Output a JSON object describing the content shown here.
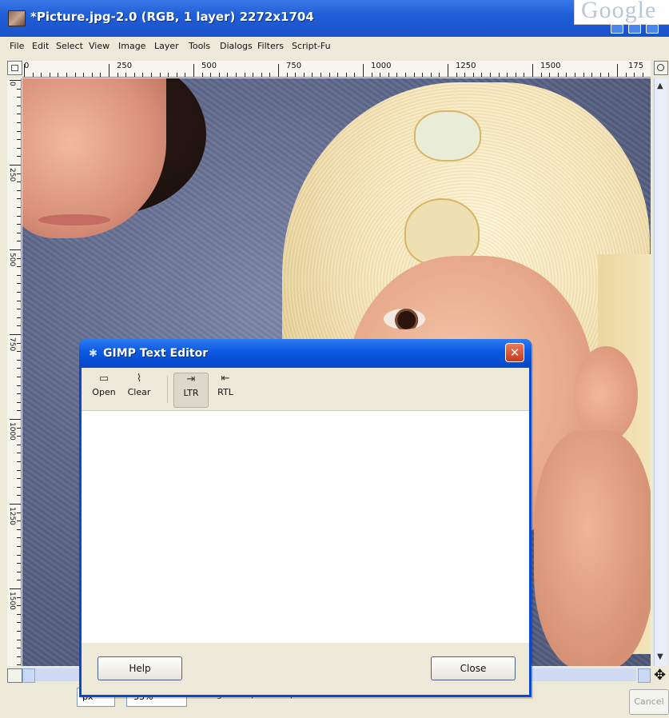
{
  "window": {
    "title": "*Picture.jpg-2.0 (RGB, 1 layer) 2272x1704",
    "background_tab_label": "Google"
  },
  "menubar": {
    "items": [
      "File",
      "Edit",
      "Select",
      "View",
      "Image",
      "Layer",
      "Tools",
      "Dialogs",
      "Filters",
      "Script-Fu"
    ]
  },
  "ruler": {
    "horizontal_labels": [
      "0",
      "250",
      "500",
      "750",
      "1000",
      "1250",
      "1500",
      "175"
    ],
    "vertical_labels": [
      "0",
      "250",
      "500",
      "750",
      "1000",
      "1250",
      "1500"
    ]
  },
  "statusbar": {
    "unit": "px",
    "zoom": "33%",
    "status_text": "Background (29.8 MB)",
    "cancel_label": "Cancel"
  },
  "dialog": {
    "title": "GIMP Text Editor",
    "toolbar": {
      "open_label": "Open",
      "clear_label": "Clear",
      "ltr_label": "LTR",
      "rtl_label": "RTL"
    },
    "text_content": "",
    "help_label": "Help",
    "close_label": "Close"
  },
  "colors": {
    "xp_titlebar": "#1f5fd8",
    "dialog_border": "#0a48d4",
    "close_button": "#c8391f",
    "window_face": "#ece9d8"
  },
  "icons": {
    "app": "gimp-image-icon",
    "dialog_title": "gimp-eye-icon",
    "open": "folder-icon",
    "clear": "broom-icon",
    "ltr": "text-ltr-icon",
    "rtl": "text-rtl-icon",
    "navigate": "move-icon"
  }
}
